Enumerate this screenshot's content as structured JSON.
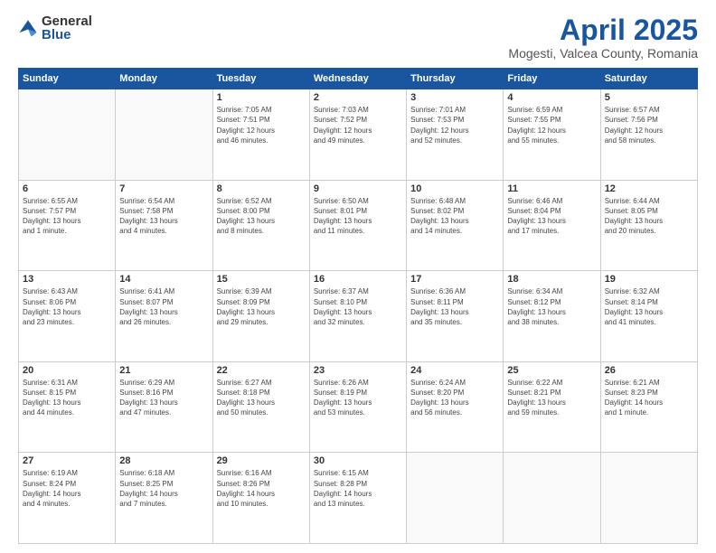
{
  "header": {
    "logo_general": "General",
    "logo_blue": "Blue",
    "month_title": "April 2025",
    "location": "Mogesti, Valcea County, Romania"
  },
  "weekdays": [
    "Sunday",
    "Monday",
    "Tuesday",
    "Wednesday",
    "Thursday",
    "Friday",
    "Saturday"
  ],
  "weeks": [
    [
      {
        "day": "",
        "info": ""
      },
      {
        "day": "",
        "info": ""
      },
      {
        "day": "1",
        "info": "Sunrise: 7:05 AM\nSunset: 7:51 PM\nDaylight: 12 hours\nand 46 minutes."
      },
      {
        "day": "2",
        "info": "Sunrise: 7:03 AM\nSunset: 7:52 PM\nDaylight: 12 hours\nand 49 minutes."
      },
      {
        "day": "3",
        "info": "Sunrise: 7:01 AM\nSunset: 7:53 PM\nDaylight: 12 hours\nand 52 minutes."
      },
      {
        "day": "4",
        "info": "Sunrise: 6:59 AM\nSunset: 7:55 PM\nDaylight: 12 hours\nand 55 minutes."
      },
      {
        "day": "5",
        "info": "Sunrise: 6:57 AM\nSunset: 7:56 PM\nDaylight: 12 hours\nand 58 minutes."
      }
    ],
    [
      {
        "day": "6",
        "info": "Sunrise: 6:55 AM\nSunset: 7:57 PM\nDaylight: 13 hours\nand 1 minute."
      },
      {
        "day": "7",
        "info": "Sunrise: 6:54 AM\nSunset: 7:58 PM\nDaylight: 13 hours\nand 4 minutes."
      },
      {
        "day": "8",
        "info": "Sunrise: 6:52 AM\nSunset: 8:00 PM\nDaylight: 13 hours\nand 8 minutes."
      },
      {
        "day": "9",
        "info": "Sunrise: 6:50 AM\nSunset: 8:01 PM\nDaylight: 13 hours\nand 11 minutes."
      },
      {
        "day": "10",
        "info": "Sunrise: 6:48 AM\nSunset: 8:02 PM\nDaylight: 13 hours\nand 14 minutes."
      },
      {
        "day": "11",
        "info": "Sunrise: 6:46 AM\nSunset: 8:04 PM\nDaylight: 13 hours\nand 17 minutes."
      },
      {
        "day": "12",
        "info": "Sunrise: 6:44 AM\nSunset: 8:05 PM\nDaylight: 13 hours\nand 20 minutes."
      }
    ],
    [
      {
        "day": "13",
        "info": "Sunrise: 6:43 AM\nSunset: 8:06 PM\nDaylight: 13 hours\nand 23 minutes."
      },
      {
        "day": "14",
        "info": "Sunrise: 6:41 AM\nSunset: 8:07 PM\nDaylight: 13 hours\nand 26 minutes."
      },
      {
        "day": "15",
        "info": "Sunrise: 6:39 AM\nSunset: 8:09 PM\nDaylight: 13 hours\nand 29 minutes."
      },
      {
        "day": "16",
        "info": "Sunrise: 6:37 AM\nSunset: 8:10 PM\nDaylight: 13 hours\nand 32 minutes."
      },
      {
        "day": "17",
        "info": "Sunrise: 6:36 AM\nSunset: 8:11 PM\nDaylight: 13 hours\nand 35 minutes."
      },
      {
        "day": "18",
        "info": "Sunrise: 6:34 AM\nSunset: 8:12 PM\nDaylight: 13 hours\nand 38 minutes."
      },
      {
        "day": "19",
        "info": "Sunrise: 6:32 AM\nSunset: 8:14 PM\nDaylight: 13 hours\nand 41 minutes."
      }
    ],
    [
      {
        "day": "20",
        "info": "Sunrise: 6:31 AM\nSunset: 8:15 PM\nDaylight: 13 hours\nand 44 minutes."
      },
      {
        "day": "21",
        "info": "Sunrise: 6:29 AM\nSunset: 8:16 PM\nDaylight: 13 hours\nand 47 minutes."
      },
      {
        "day": "22",
        "info": "Sunrise: 6:27 AM\nSunset: 8:18 PM\nDaylight: 13 hours\nand 50 minutes."
      },
      {
        "day": "23",
        "info": "Sunrise: 6:26 AM\nSunset: 8:19 PM\nDaylight: 13 hours\nand 53 minutes."
      },
      {
        "day": "24",
        "info": "Sunrise: 6:24 AM\nSunset: 8:20 PM\nDaylight: 13 hours\nand 56 minutes."
      },
      {
        "day": "25",
        "info": "Sunrise: 6:22 AM\nSunset: 8:21 PM\nDaylight: 13 hours\nand 59 minutes."
      },
      {
        "day": "26",
        "info": "Sunrise: 6:21 AM\nSunset: 8:23 PM\nDaylight: 14 hours\nand 1 minute."
      }
    ],
    [
      {
        "day": "27",
        "info": "Sunrise: 6:19 AM\nSunset: 8:24 PM\nDaylight: 14 hours\nand 4 minutes."
      },
      {
        "day": "28",
        "info": "Sunrise: 6:18 AM\nSunset: 8:25 PM\nDaylight: 14 hours\nand 7 minutes."
      },
      {
        "day": "29",
        "info": "Sunrise: 6:16 AM\nSunset: 8:26 PM\nDaylight: 14 hours\nand 10 minutes."
      },
      {
        "day": "30",
        "info": "Sunrise: 6:15 AM\nSunset: 8:28 PM\nDaylight: 14 hours\nand 13 minutes."
      },
      {
        "day": "",
        "info": ""
      },
      {
        "day": "",
        "info": ""
      },
      {
        "day": "",
        "info": ""
      }
    ]
  ]
}
